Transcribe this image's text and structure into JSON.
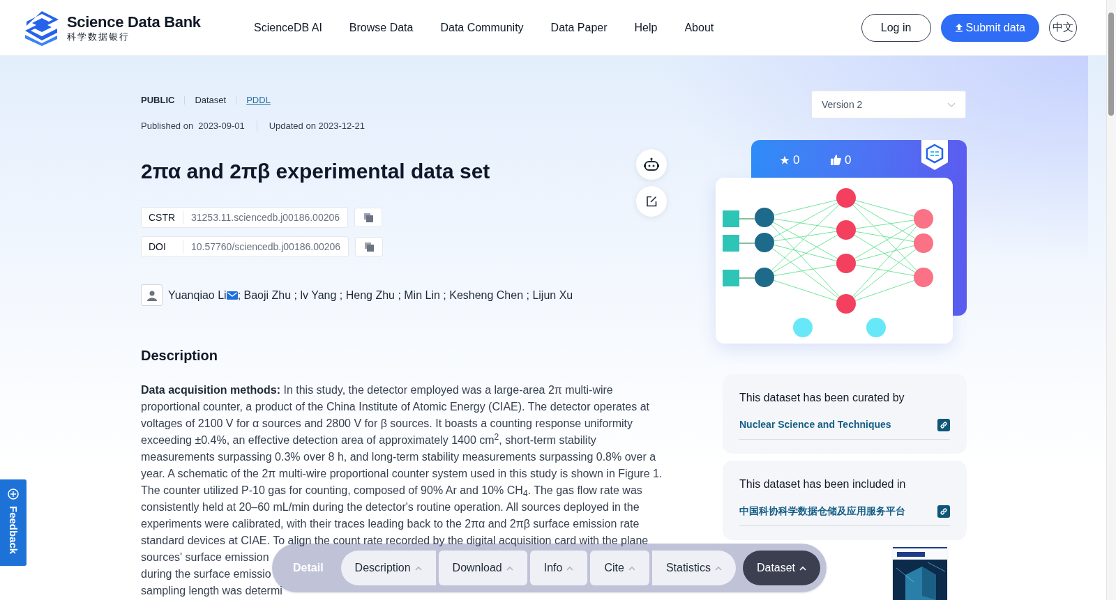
{
  "header": {
    "logo_title": "Science Data Bank",
    "logo_subtitle": "科学数据银行",
    "nav": [
      "ScienceDB AI",
      "Browse Data",
      "Data Community",
      "Data Paper",
      "Help",
      "About"
    ],
    "login": "Log in",
    "submit": "Submit data",
    "language": "中文"
  },
  "meta": {
    "access": "PUBLIC",
    "type": "Dataset",
    "license": "PDDL",
    "published_label": "Published on",
    "published": "2023-09-01",
    "updated": "Updated on 2023-12-21"
  },
  "title": "2πα and 2πβ experimental data set",
  "identifiers": [
    {
      "label": "CSTR",
      "value": "31253.11.sciencedb.j00186.00206"
    },
    {
      "label": "DOI",
      "value": "10.57760/sciencedb.j00186.00206"
    }
  ],
  "authors": [
    {
      "text": "Yuanqiao Li",
      "email": true
    },
    {
      "text": "; Baoji Zhu ; lv Yang ; Heng Zhu ; Min Lin ; Kesheng Chen ; Lijun Xu",
      "email": false
    }
  ],
  "description": {
    "heading": "Description",
    "text": "**Data acquisition methods:** In this study, the detector employed was a large-area 2π multi-wire proportional counter, a product of the China Institute of Atomic Energy (CIAE). The detector operates at voltages of 2100 V for α sources and 2800 V for β sources. It boasts a counting response uniformity exceeding ±0.4%, an effective detection area of approximately 1400 cm$^{2}$, short-term stability measurements surpassing 0.3% over 8 h, and long-term stability measurements surpassing 0.8% over a year. A schematic of the 2π multi-wire proportional counter system used in this study is shown in Figure 1. The counter utilized P-10 gas for counting, composed of 90% Ar and 10% CH$_{4}$. The gas flow rate was consistently held at 20–60 mL/min during the detector's routine operation. All sources deployed in the experiments were calibrated, with their traces leading back to the 2πα and 2πβ surface emission rate standard devices at CIAE. To align the count rate recorded by the digital acquisition card with the plane",
    "cut_lines": [
      "sources' surface emission",
      "during the surface emissio",
      "sampling length was determi"
    ]
  },
  "sidebar": {
    "version": "Version 2",
    "stars": "0",
    "likes": "0",
    "cards": [
      {
        "caption": "This dataset has been curated by",
        "link": "Nuclear Science and Techniques"
      },
      {
        "caption": "This dataset has been included in",
        "link": "中国科协科学数据仓储及应用服务平台"
      }
    ]
  },
  "bottom_nav": {
    "label": "Detail",
    "tabs": [
      {
        "label": "Description",
        "selected": false
      },
      {
        "label": "Download",
        "selected": false
      },
      {
        "label": "Info",
        "selected": false
      },
      {
        "label": "Cite",
        "selected": false
      },
      {
        "label": "Statistics",
        "selected": false
      },
      {
        "label": "Dataset",
        "selected": true
      }
    ]
  },
  "feedback": "Feedback"
}
